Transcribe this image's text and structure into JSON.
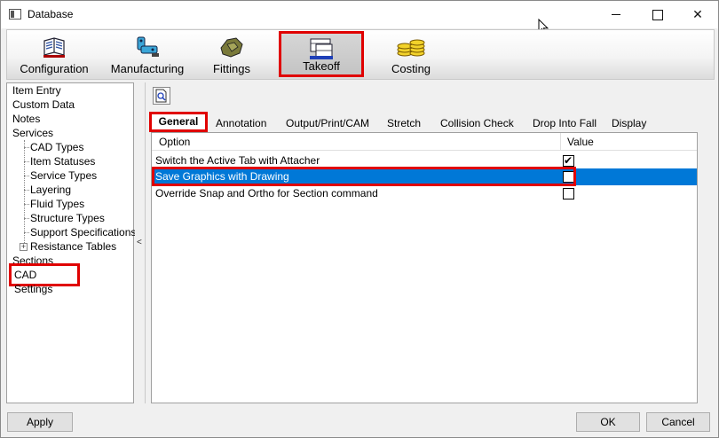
{
  "window": {
    "title": "Database",
    "controls": [
      "minimize",
      "maximize",
      "close"
    ],
    "close_glyph": "✕"
  },
  "ribbon": {
    "items": [
      {
        "label": "Configuration",
        "icon": "configuration-icon"
      },
      {
        "label": "Manufacturing",
        "icon": "manufacturing-icon"
      },
      {
        "label": "Fittings",
        "icon": "fittings-icon"
      },
      {
        "label": "Takeoff",
        "icon": "takeoff-icon",
        "selected": true
      },
      {
        "label": "Costing",
        "icon": "costing-icon"
      }
    ]
  },
  "tree": {
    "items": [
      {
        "label": "Item Entry"
      },
      {
        "label": "Custom Data"
      },
      {
        "label": "Notes"
      },
      {
        "label": "Services"
      },
      {
        "label": "CAD Types",
        "child": true
      },
      {
        "label": "Item Statuses",
        "child": true
      },
      {
        "label": "Service Types",
        "child": true
      },
      {
        "label": "Layering",
        "child": true
      },
      {
        "label": "Fluid Types",
        "child": true
      },
      {
        "label": "Structure Types",
        "child": true
      },
      {
        "label": "Support Specifications",
        "child": true
      },
      {
        "label": "Resistance Tables",
        "child": true,
        "expandable": true
      },
      {
        "label": "Sections"
      },
      {
        "label": "CAD Settings",
        "selected": true
      }
    ],
    "expander_glyph": "+",
    "splitter_glyph": "<"
  },
  "tabs": [
    "General",
    "Annotation",
    "Output/Print/CAM",
    "Stretch",
    "Collision Check",
    "Drop Into Fall",
    "Display"
  ],
  "grid": {
    "columns": [
      "Option",
      "Value"
    ],
    "rows": [
      {
        "option": "Switch the Active Tab with Attacher",
        "checked": true
      },
      {
        "option": "Save Graphics with Drawing",
        "checked": false,
        "selected": true
      },
      {
        "option": "Override Snap and Ortho for Section command",
        "checked": false
      }
    ]
  },
  "buttons": {
    "apply": "Apply",
    "ok": "OK",
    "cancel": "Cancel"
  },
  "colors": {
    "highlight_red": "#e00000",
    "selection_blue": "#0078d7"
  }
}
